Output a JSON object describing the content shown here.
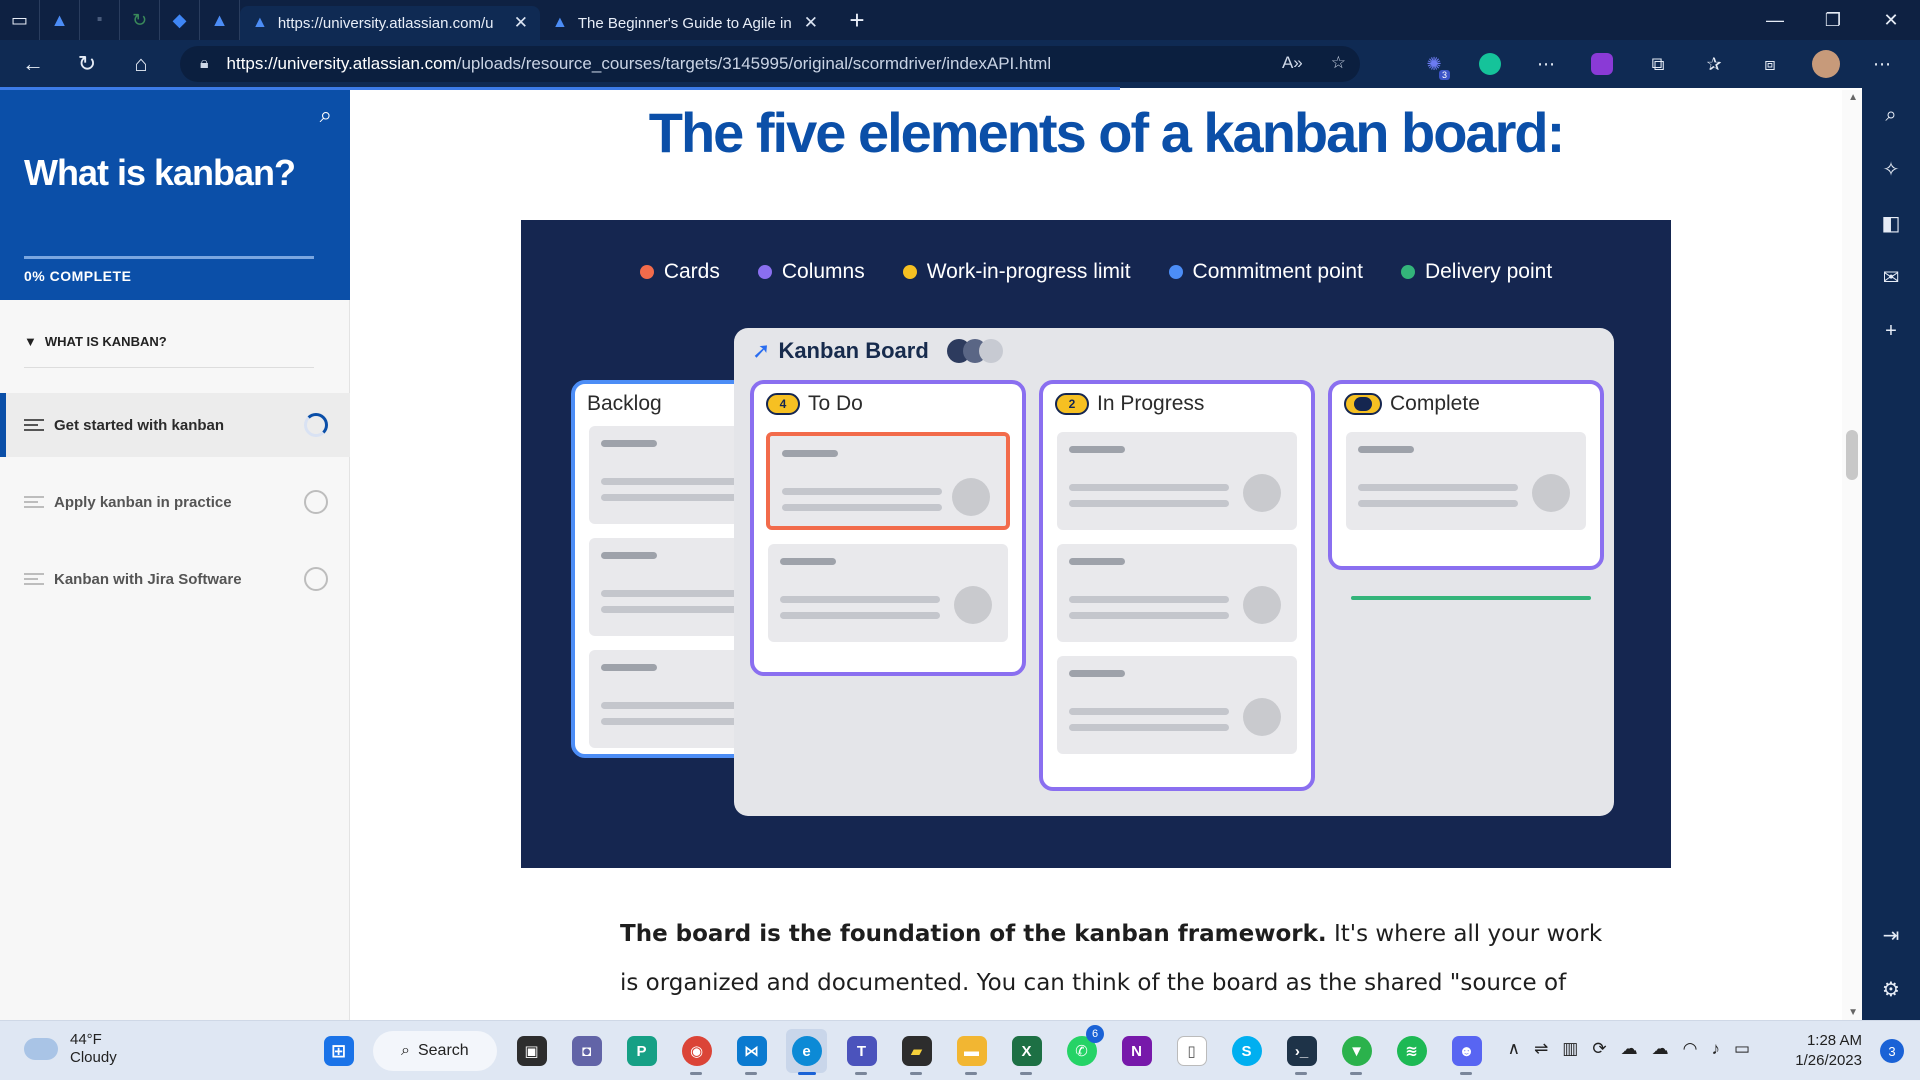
{
  "browser": {
    "tabs": [
      {
        "title": "https://university.atlassian.com/u",
        "active": true
      },
      {
        "title": "The Beginner's Guide to Agile in",
        "active": false
      }
    ],
    "url_domain": "https://university.atlassian.com",
    "url_path": "/uploads/resource_courses/targets/3145995/original/scormdriver/indexAPI.html",
    "extension_badge": "3"
  },
  "course": {
    "title": "What is kanban?",
    "progress_label": "0% COMPLETE",
    "progress": 0,
    "section": "WHAT IS KANBAN?",
    "lessons": [
      {
        "label": "Get started with kanban",
        "state": "in-progress"
      },
      {
        "label": "Apply kanban in practice",
        "state": "not-started"
      },
      {
        "label": "Kanban with Jira Software",
        "state": "not-started"
      }
    ]
  },
  "content": {
    "heading": "The five elements of a kanban board:",
    "legend": [
      {
        "label": "Cards",
        "color": "#f26b4b"
      },
      {
        "label": "Columns",
        "color": "#8a6ff0"
      },
      {
        "label": "Work-in-progress limit",
        "color": "#f6c022"
      },
      {
        "label": "Commitment point",
        "color": "#4c8df6"
      },
      {
        "label": "Delivery point",
        "color": "#33b47a"
      }
    ],
    "board_title": "Kanban Board",
    "columns": [
      {
        "title": "Backlog",
        "badge": ""
      },
      {
        "title": "To Do",
        "badge": "4"
      },
      {
        "title": "In Progress",
        "badge": "2"
      },
      {
        "title": "Complete",
        "badge": ""
      }
    ],
    "para_bold": "The board is the foundation of the kanban framework.",
    "para_rest": " It's where all your work is organized and documented. You can think of the board as the shared \"source of"
  },
  "taskbar": {
    "weather_temp": "44°F",
    "weather_desc": "Cloudy",
    "search_label": "Search",
    "teams_badge": "6",
    "time": "1:28 AM",
    "date": "1/26/2023",
    "notification_count": "3"
  }
}
